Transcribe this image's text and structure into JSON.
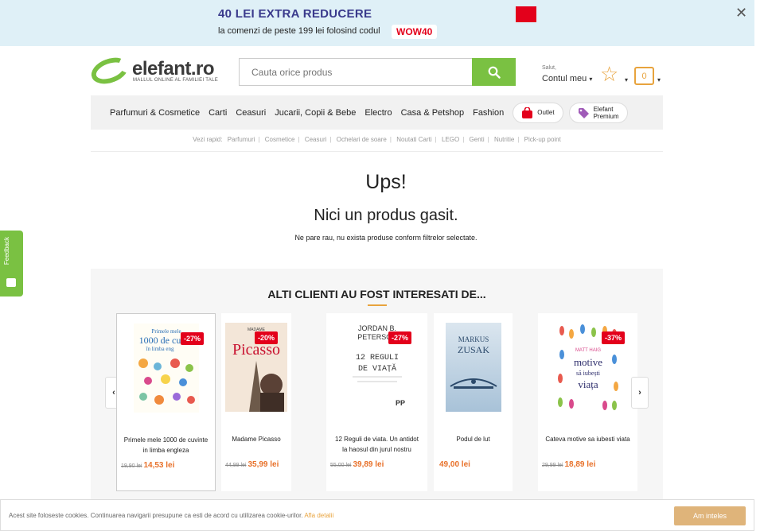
{
  "promo": {
    "title": "40 LEI EXTRA REDUCERE",
    "text": "la comenzi de peste 199 lei folosind codul",
    "code": "WOW40",
    "close": "✕"
  },
  "logo": {
    "name": "elefant.ro",
    "tagline": "MALLUL ONLINE AL FAMILIEI TALE"
  },
  "search": {
    "placeholder": "Cauta orice produs"
  },
  "account": {
    "greeting": "Salut,",
    "label": "Contul meu"
  },
  "cart": {
    "count": "0"
  },
  "nav": {
    "items": [
      "Parfumuri & Cosmetice",
      "Carti",
      "Ceasuri",
      "Jucarii, Copii & Bebe",
      "Electro",
      "Casa & Petshop",
      "Fashion"
    ],
    "outlet": "Outlet",
    "premium_line1": "Elefant",
    "premium_line2": "Premium"
  },
  "quick": {
    "label": "Vezi rapid:",
    "links": [
      "Parfumuri",
      "Cosmetice",
      "Ceasuri",
      "Ochelari de soare",
      "Noutati Carti",
      "LEGO",
      "Genti",
      "Nutritie",
      "Pick-up point"
    ]
  },
  "empty": {
    "title": "Ups!",
    "subtitle": "Nici un produs gasit.",
    "message": "Ne pare rau, nu exista produse conform filtrelor selectate."
  },
  "recommendations": {
    "heading": "ALTI CLIENTI AU FOST INTERESATI DE...",
    "products": [
      {
        "name": "Primele mele 1000 de cuvinte in limba engleza",
        "old_price": "19,90 lei",
        "price": "14,53 lei",
        "discount": "-27%",
        "cover_text": "Primele mele 1000 de cuvinte în limba engleză"
      },
      {
        "name": "Madame Picasso",
        "old_price": "44,99 lei",
        "price": "35,99 lei",
        "discount": "-20%",
        "cover_text": "Picasso"
      },
      {
        "name": "12 Reguli de viata. Un antidot la haosul din jurul nostru",
        "old_price": "55,00 lei",
        "price": "39,89 lei",
        "discount": "-27%",
        "cover_text": "JORDAN B. PETERSON 12 REGULI DE VIAȚĂ"
      },
      {
        "name": "Podul de lut",
        "old_price": "",
        "price": "49,00 lei",
        "discount": "",
        "cover_text": "MARKUS ZUSAK"
      },
      {
        "name": "Cateva motive sa iubesti viata",
        "old_price": "29,99 lei",
        "price": "18,89 lei",
        "discount": "-37%",
        "cover_text": "MATT HAIG câteva motive să iubești viața"
      }
    ]
  },
  "feedback": {
    "label": "Feedback"
  },
  "cookie": {
    "text": "Acest site foloseste cookies. Continuarea navigarii presupune ca esti de acord cu utilizarea cookie-urilor.",
    "link": "Afla detalii",
    "button": "Am inteles"
  },
  "colors": {
    "brand_green": "#7ac142",
    "accent_orange": "#e8712a",
    "discount_red": "#e3001b",
    "promo_bg": "#dff0f7"
  }
}
